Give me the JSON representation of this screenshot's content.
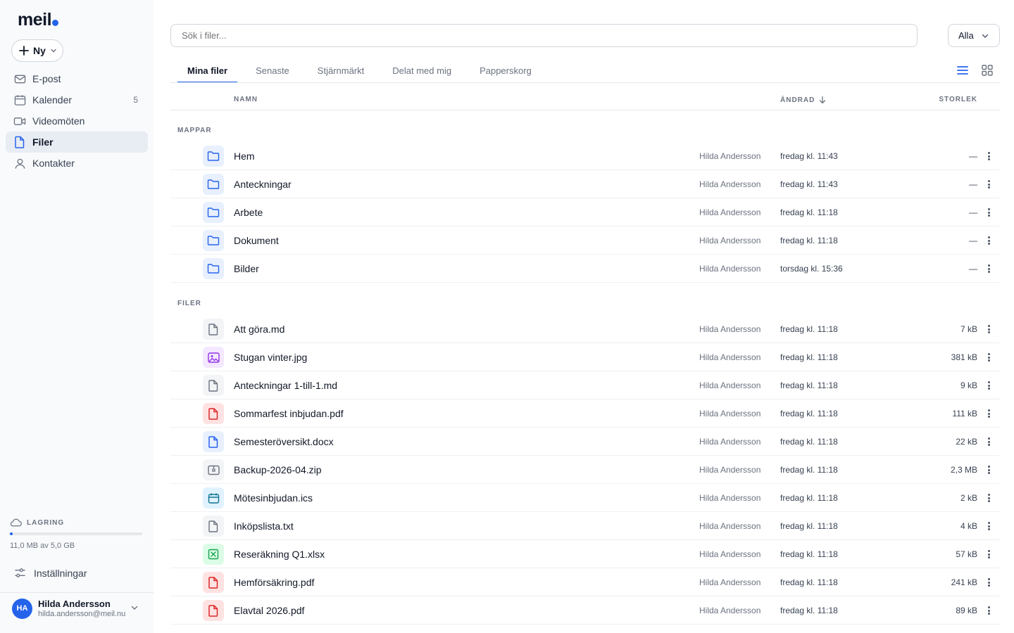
{
  "app": {
    "logo": "meil"
  },
  "sidebar": {
    "new_label": "Ny",
    "items": [
      {
        "label": "E-post",
        "icon": "mail-icon",
        "count": ""
      },
      {
        "label": "Kalender",
        "icon": "calendar-icon",
        "count": "5"
      },
      {
        "label": "Videomöten",
        "icon": "video-icon",
        "count": ""
      },
      {
        "label": "Filer",
        "icon": "file-icon",
        "count": "",
        "active": true
      },
      {
        "label": "Kontakter",
        "icon": "user-icon",
        "count": ""
      }
    ],
    "storage": {
      "label": "LAGRING",
      "text": "11,0 MB av 5,0 GB",
      "used_fraction": 0.0022
    },
    "settings_label": "Inställningar",
    "user": {
      "initials": "HA",
      "name": "Hilda Andersson",
      "email": "hilda.andersson@meil.nu"
    }
  },
  "search": {
    "placeholder": "Sök i filer..."
  },
  "filter": {
    "value": "Alla"
  },
  "tabs": [
    "Mina filer",
    "Senaste",
    "Stjärnmärkt",
    "Delat med mig",
    "Papperskorg"
  ],
  "table": {
    "col_name": "NAMN",
    "col_modified": "ÄNDRAD",
    "col_size": "STORLEK"
  },
  "sections": {
    "folders": "MAPPAR",
    "files": "FILER"
  },
  "folders": [
    {
      "name": "Hem",
      "owner": "Hilda Andersson",
      "date": "fredag kl. 11:43",
      "size": "—"
    },
    {
      "name": "Anteckningar",
      "owner": "Hilda Andersson",
      "date": "fredag kl. 11:43",
      "size": "—"
    },
    {
      "name": "Arbete",
      "owner": "Hilda Andersson",
      "date": "fredag kl. 11:18",
      "size": "—"
    },
    {
      "name": "Dokument",
      "owner": "Hilda Andersson",
      "date": "fredag kl. 11:18",
      "size": "—"
    },
    {
      "name": "Bilder",
      "owner": "Hilda Andersson",
      "date": "torsdag kl. 15:36",
      "size": "—"
    }
  ],
  "files": [
    {
      "name": "Att göra.md",
      "type": "doc",
      "owner": "Hilda Andersson",
      "date": "fredag kl. 11:18",
      "size": "7 kB"
    },
    {
      "name": "Stugan vinter.jpg",
      "type": "image",
      "owner": "Hilda Andersson",
      "date": "fredag kl. 11:18",
      "size": "381 kB"
    },
    {
      "name": "Anteckningar 1-till-1.md",
      "type": "doc",
      "owner": "Hilda Andersson",
      "date": "fredag kl. 11:18",
      "size": "9 kB"
    },
    {
      "name": "Sommarfest inbjudan.pdf",
      "type": "pdf",
      "owner": "Hilda Andersson",
      "date": "fredag kl. 11:18",
      "size": "111 kB"
    },
    {
      "name": "Semesteröversikt.docx",
      "type": "word",
      "owner": "Hilda Andersson",
      "date": "fredag kl. 11:18",
      "size": "22 kB"
    },
    {
      "name": "Backup-2026-04.zip",
      "type": "zip",
      "owner": "Hilda Andersson",
      "date": "fredag kl. 11:18",
      "size": "2,3 MB"
    },
    {
      "name": "Mötesinbjudan.ics",
      "type": "cal",
      "owner": "Hilda Andersson",
      "date": "fredag kl. 11:18",
      "size": "2 kB"
    },
    {
      "name": "Inköpslista.txt",
      "type": "doc",
      "owner": "Hilda Andersson",
      "date": "fredag kl. 11:18",
      "size": "4 kB"
    },
    {
      "name": "Reseräkning Q1.xlsx",
      "type": "xls",
      "owner": "Hilda Andersson",
      "date": "fredag kl. 11:18",
      "size": "57 kB"
    },
    {
      "name": "Hemförsäkring.pdf",
      "type": "pdf",
      "owner": "Hilda Andersson",
      "date": "fredag kl. 11:18",
      "size": "241 kB"
    },
    {
      "name": "Elavtal 2026.pdf",
      "type": "pdf",
      "owner": "Hilda Andersson",
      "date": "fredag kl. 11:18",
      "size": "89 kB"
    }
  ],
  "colors": {
    "accent": "#2563eb"
  }
}
